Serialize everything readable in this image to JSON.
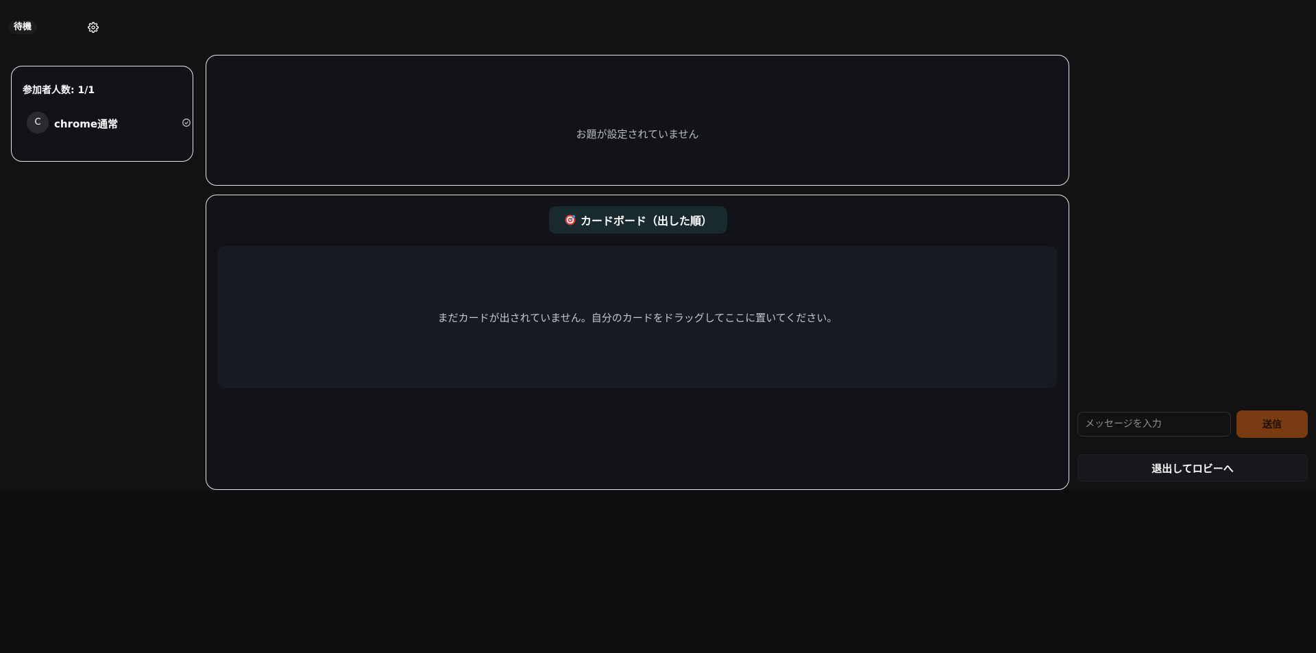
{
  "header": {
    "status_label": "待機",
    "settings_icon": "gear-icon"
  },
  "participants": {
    "count_label": "参加者人数: 1/1",
    "members": [
      {
        "initial": "C",
        "name": "chrome通常",
        "status_icon": "check-circle-icon"
      }
    ]
  },
  "topic": {
    "empty_message": "お題が設定されていません"
  },
  "board": {
    "title_icon": "target-icon",
    "title": "カードボード（出した順）",
    "empty_message": "まだカードが出されていません。自分のカードをドラッグしてここに置いてください。"
  },
  "chat": {
    "input_value": "",
    "input_placeholder": "メッセージを入力",
    "send_label": "送信"
  },
  "actions": {
    "leave_label": "退出してロビーへ"
  },
  "colors": {
    "background": "#121212",
    "panel_border": "#e8e8e8",
    "send_button": "#7a3a12",
    "board_title_bg": "#182a2d"
  }
}
